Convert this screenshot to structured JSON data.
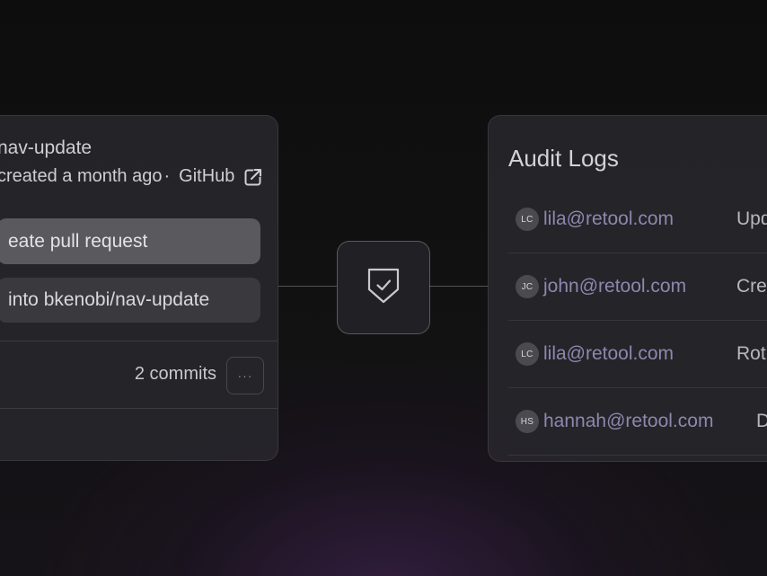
{
  "branch_card": {
    "title": "nav-update",
    "meta_text": "created a month ago",
    "separator": "·",
    "source_link": "GitHub",
    "source_icon": "external-link-icon",
    "create_pr_label": "eate pull request",
    "merge_label": "into bkenobi/nav-update",
    "commits_label": "2 commits",
    "more_label": "···"
  },
  "connector": {
    "icon": "shield-check-icon"
  },
  "audit_logs": {
    "title": "Audit Logs",
    "rows": [
      {
        "initials": "LC",
        "email": "lila@retool.com",
        "action": "Upd"
      },
      {
        "initials": "JC",
        "email": "john@retool.com",
        "action": "Cre"
      },
      {
        "initials": "LC",
        "email": "lila@retool.com",
        "action": "Rot"
      },
      {
        "initials": "HS",
        "email": "hannah@retool.com",
        "action": "Del"
      }
    ]
  },
  "colors": {
    "email_link": "#8e87ae",
    "card_bg": "#28272c",
    "primary_button": "#5a595e",
    "secondary_button": "#3a393e"
  }
}
